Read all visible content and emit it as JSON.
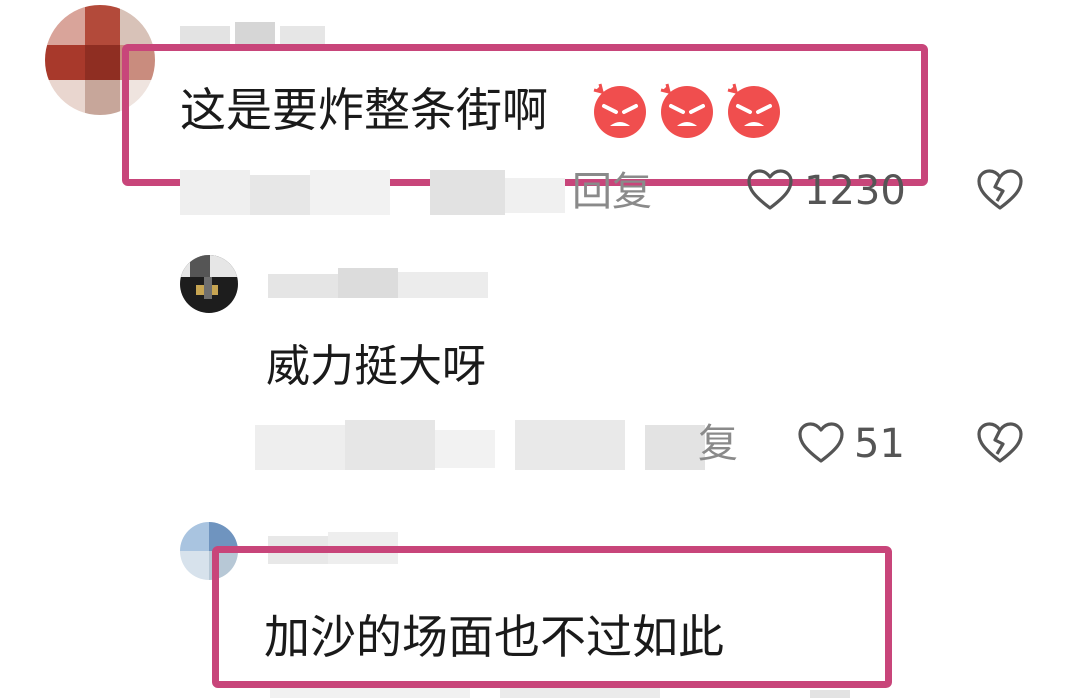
{
  "comments": [
    {
      "text": "这是要炸整条街啊",
      "emoji": [
        "angry-face",
        "angry-face",
        "angry-face"
      ],
      "reply_label": "回复",
      "like_count": "1230"
    },
    {
      "text": "威力挺大呀",
      "reply_label": "复",
      "like_count": "51"
    },
    {
      "text": "加沙的场面也不过如此"
    }
  ],
  "icons": {
    "like": "heart-outline-icon",
    "dislike": "broken-heart-icon"
  },
  "colors": {
    "highlight_border": "#c8457a",
    "text": "#1a1a1a",
    "meta": "#8a8a8a",
    "icon": "#555555",
    "emoji_face": "#f04e4e"
  }
}
